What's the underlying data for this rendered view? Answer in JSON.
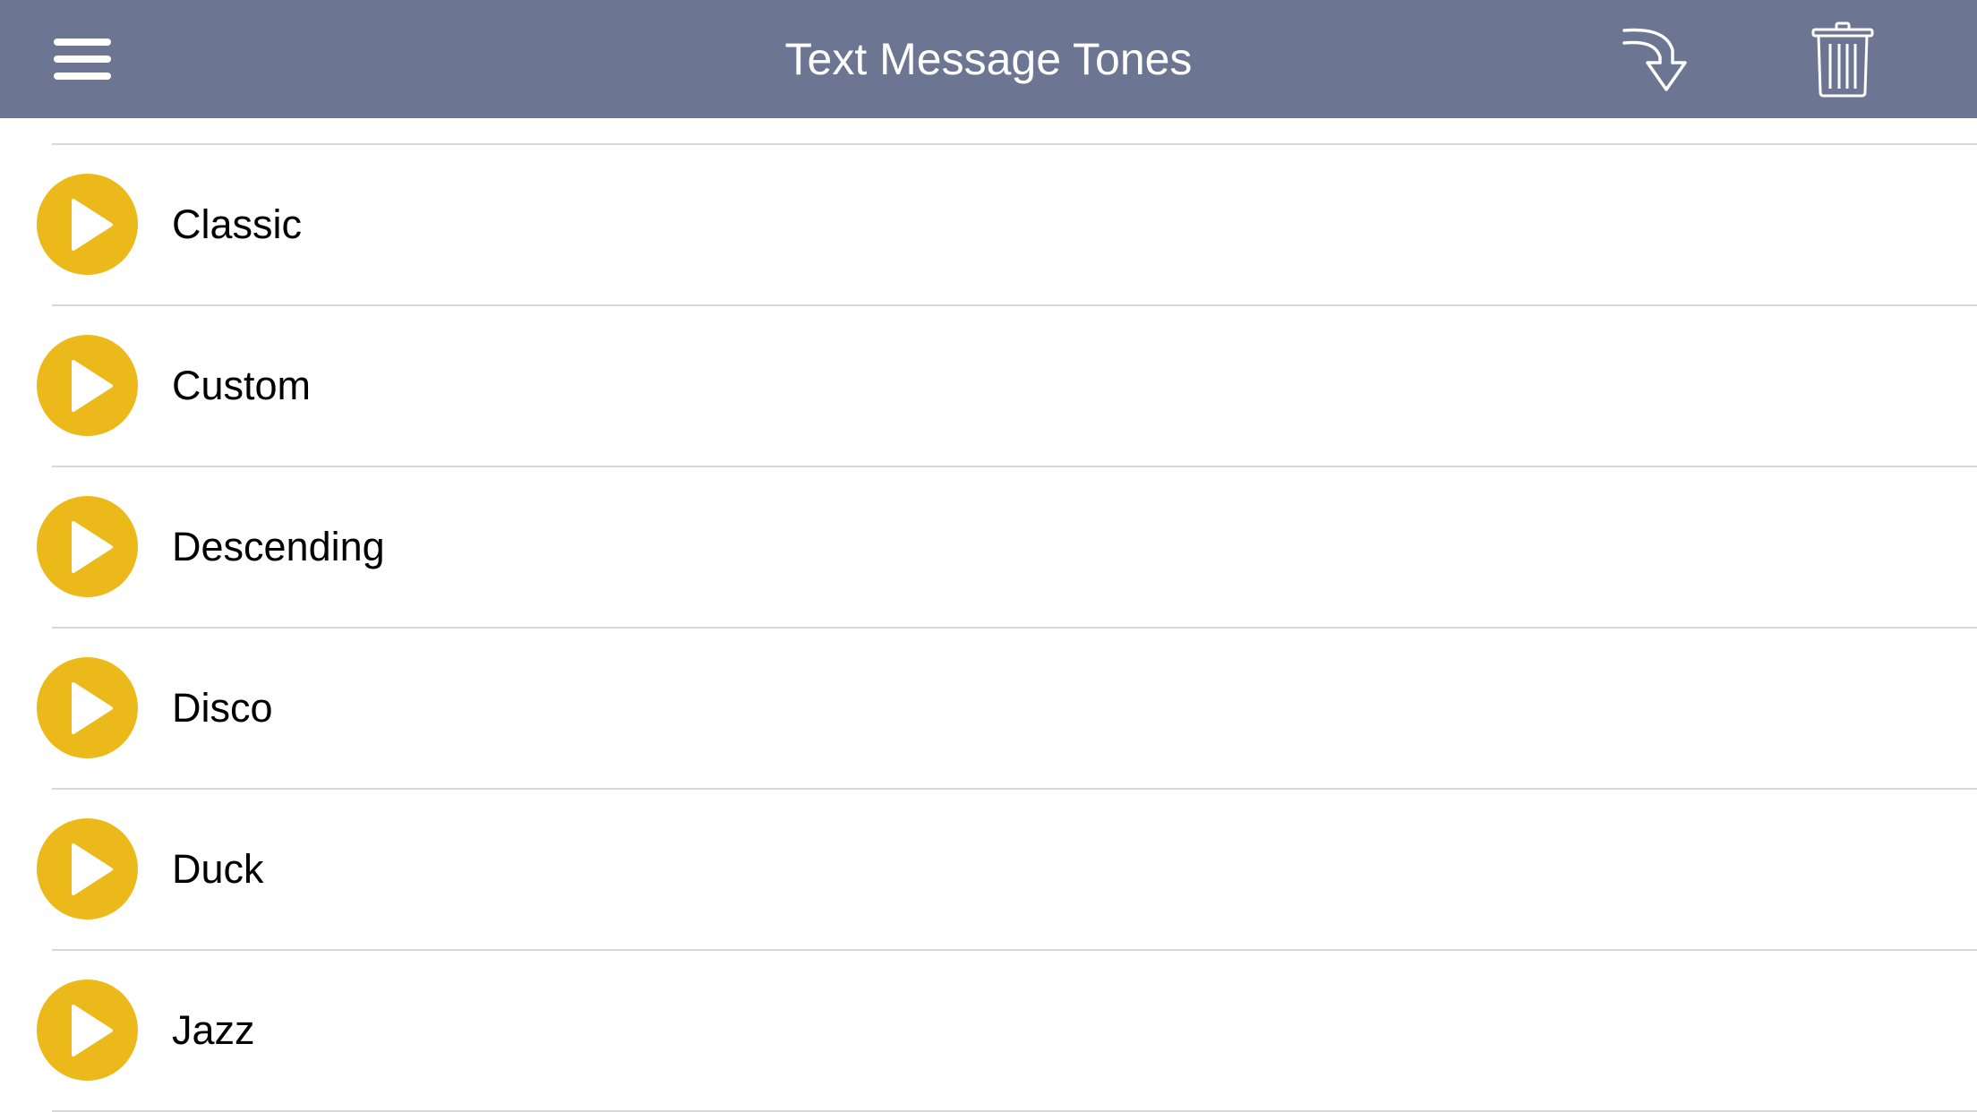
{
  "header": {
    "title": "Text Message Tones",
    "icons": {
      "menu": "hamburger-menu-icon",
      "import": "curved-arrow-down-icon",
      "delete": "trash-icon"
    },
    "background": "#6c7591",
    "text_color": "#ffffff"
  },
  "tones": [
    {
      "label": "Classic"
    },
    {
      "label": "Custom"
    },
    {
      "label": "Descending"
    },
    {
      "label": "Disco"
    },
    {
      "label": "Duck"
    },
    {
      "label": "Jazz"
    }
  ],
  "colors": {
    "play_button": "#ecb91a",
    "separator": "#d7d7dc"
  }
}
